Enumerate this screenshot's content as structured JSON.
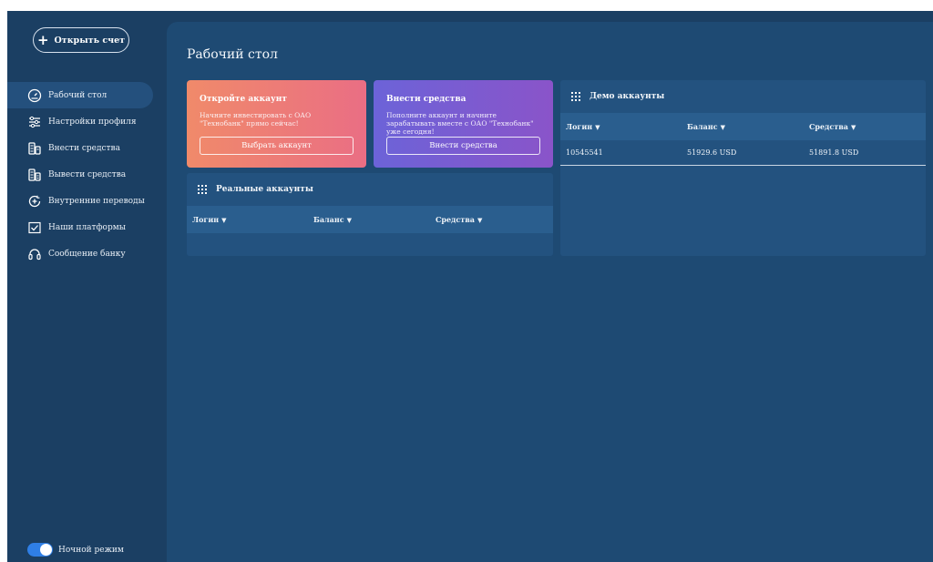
{
  "sidebar": {
    "open_button": "Открыть счет",
    "items": [
      {
        "label": "Рабочий стол",
        "icon": "dashboard-gauge-icon"
      },
      {
        "label": "Настройки профиля",
        "icon": "sliders-icon"
      },
      {
        "label": "Внести средства",
        "icon": "coins-in-icon"
      },
      {
        "label": "Вывести средства",
        "icon": "coins-out-icon"
      },
      {
        "label": "Внутренние переводы",
        "icon": "transfer-plus-icon"
      },
      {
        "label": "Наши платформы",
        "icon": "checkbox-icon"
      },
      {
        "label": "Сообщение банку",
        "icon": "headset-icon"
      }
    ],
    "night_mode": "Ночной режим"
  },
  "main": {
    "title": "Рабочий стол",
    "card_open": {
      "title": "Откройте аккаунт",
      "text": "Начните инвестировать с ОАО \"Технобанк\" прямо сейчас!",
      "button": "Выбрать аккаунт"
    },
    "card_deposit": {
      "title": "Внести средства",
      "text": "Пополните аккаунт и начните зарабатывать вместе с ОАО \"Технобанк\" уже сегодня!",
      "button": "Внести средства"
    },
    "real_accounts": {
      "title": "Реальные аккаунты",
      "columns": [
        "Логин",
        "Баланс",
        "Средства"
      ]
    },
    "demo_accounts": {
      "title": "Демо аккаунты",
      "columns": [
        "Логин",
        "Баланс",
        "Средства"
      ],
      "rows": [
        {
          "login": "10545541",
          "balance": "51929.6 USD",
          "funds": "51891.8 USD"
        }
      ]
    }
  },
  "colors": {
    "sidebar_bg": "#1b3f63",
    "main_bg": "#1e4a73",
    "panel_bg": "#23527f",
    "card_open_gradient": "#f08a6a → #ea6e84",
    "card_deposit_gradient": "#6c63d8 → #8a54c9",
    "toggle_accent": "#2f7fe6"
  }
}
